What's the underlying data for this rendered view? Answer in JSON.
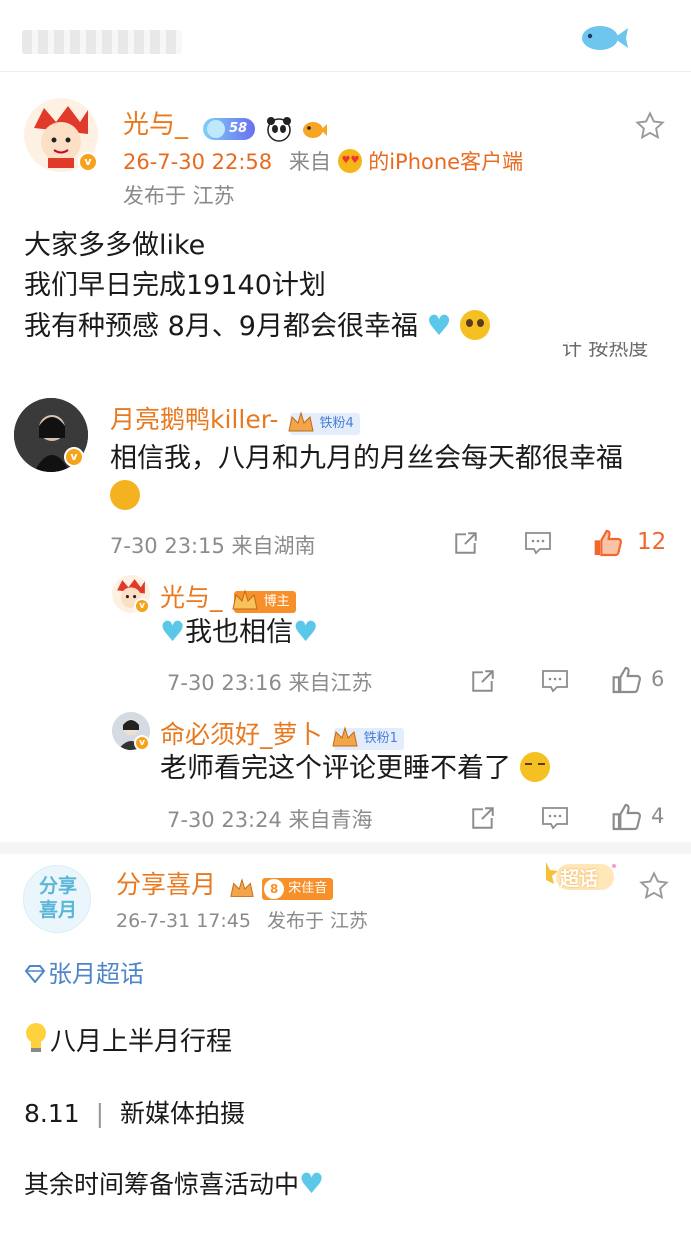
{
  "post1": {
    "name": "光与_",
    "level_badge": "58",
    "timestamp": "26-7-30 22:58",
    "source_prefix": "来自",
    "source_suffix": "的iPhone客户端",
    "location": "发布于 江苏",
    "lines": [
      "大家多多做like",
      "我们早日完成19140计划",
      "我有种预感 8月、9月都会很幸福"
    ],
    "cutoff_text": "计 按热度"
  },
  "comment1": {
    "name": "月亮鹅鸭killer-",
    "badge": "铁粉4",
    "text": "相信我，八月和九月的月丝会每天都很幸福",
    "time": "7-30 23:15 来自湖南",
    "likes": "12"
  },
  "reply1": {
    "name": "光与_",
    "badge": "博主",
    "text": "我也相信",
    "time": "7-30 23:16 来自江苏",
    "likes": "6"
  },
  "reply2": {
    "name": "命必须好_萝卜",
    "badge": "铁粉1",
    "text": "老师看完这个评论更睡不着了",
    "time": "7-30 23:24 来自青海",
    "likes": "4"
  },
  "post2": {
    "avatar_text_1": "分享",
    "avatar_text_2": "喜月",
    "name": "分享喜月",
    "fan_level": "8",
    "fan_badge": "宋佳音",
    "timestamp": "26-7-31 17:45",
    "location": "发布于 江苏",
    "super_topic_tag": "超话",
    "topic": "张月超话",
    "line1": "八月上半月行程",
    "date": "8.11",
    "separator": "|",
    "event": "新媒体拍摄",
    "line3": "其余时间筹备惊喜活动中"
  },
  "colors": {
    "accent": "#e8791f",
    "meta": "#8c8c8c",
    "heart_blue": "#5bc8ea",
    "like_active": "#f2662a"
  }
}
